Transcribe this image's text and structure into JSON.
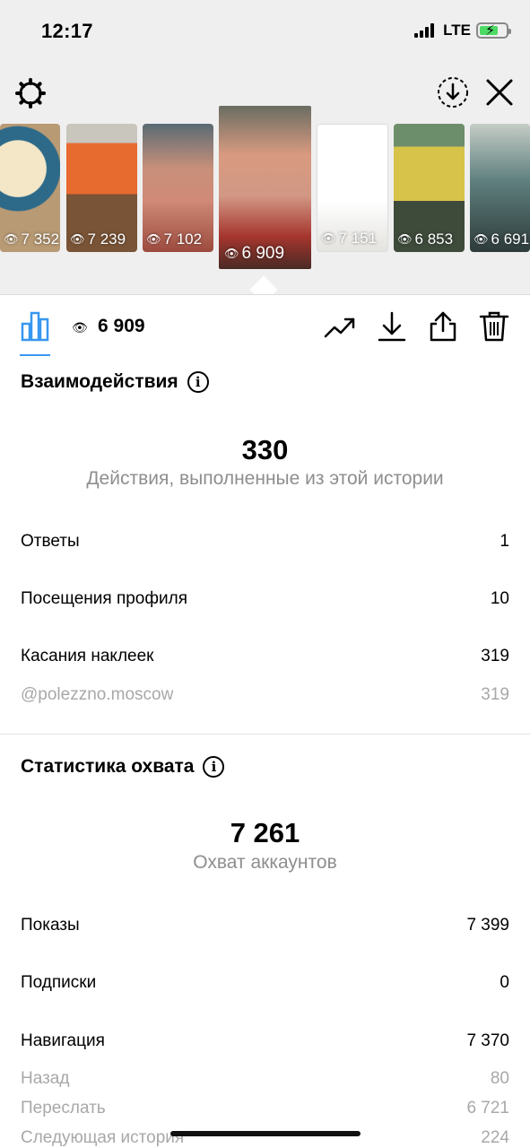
{
  "status_bar": {
    "time": "12:17",
    "network": "LTE"
  },
  "stories": [
    {
      "views": "7 352",
      "active": false
    },
    {
      "views": "7 239",
      "active": false
    },
    {
      "views": "7 102",
      "active": false
    },
    {
      "views": "6 909",
      "active": true
    },
    {
      "views": "7 151",
      "active": false
    },
    {
      "views": "6 853",
      "active": false
    },
    {
      "views": "6 691",
      "active": false
    }
  ],
  "toolbar": {
    "view_count": "6 909"
  },
  "interactions": {
    "title": "Взаимодействия",
    "total": "330",
    "total_label": "Действия, выполненные из этой истории",
    "rows": [
      {
        "label": "Ответы",
        "value": "1"
      },
      {
        "label": "Посещения профиля",
        "value": "10"
      },
      {
        "label": "Касания наклеек",
        "value": "319"
      }
    ],
    "sticker_sub": {
      "label": "@polezzno.moscow",
      "value": "319"
    }
  },
  "reach": {
    "title": "Статистика охвата",
    "total": "7 261",
    "total_label": "Охват аккаунтов",
    "rows": [
      {
        "label": "Показы",
        "value": "7 399"
      },
      {
        "label": "Подписки",
        "value": "0"
      },
      {
        "label": "Навигация",
        "value": "7 370"
      }
    ],
    "navigation_sub": [
      {
        "label": "Назад",
        "value": "80"
      },
      {
        "label": "Переслать",
        "value": "6 721"
      },
      {
        "label": "Следующая история",
        "value": "224"
      }
    ]
  },
  "icons": {
    "settings": "gear-icon",
    "download_circle": "download-circle-icon",
    "close": "close-icon",
    "insights": "bar-chart-icon",
    "eye": "eye-icon",
    "trend": "trend-icon",
    "save": "download-icon",
    "share": "share-icon",
    "delete": "trash-icon",
    "info": "info-icon"
  },
  "colors": {
    "accent": "#3897f0",
    "muted": "#8e8e8e",
    "battery": "#4cd964"
  }
}
